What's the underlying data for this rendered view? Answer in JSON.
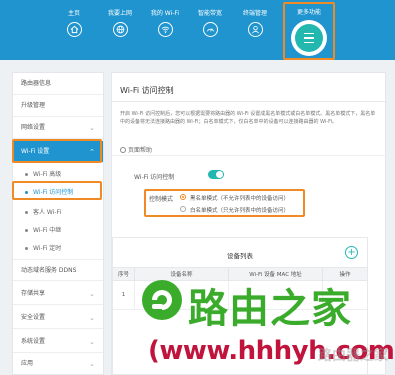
{
  "nav": {
    "items": [
      {
        "label": "主页",
        "icon": "home-icon"
      },
      {
        "label": "我要上网",
        "icon": "globe-icon"
      },
      {
        "label": "我的 Wi-Fi",
        "icon": "wifi-icon"
      },
      {
        "label": "智能带宽",
        "icon": "speed-dial-icon"
      },
      {
        "label": "终端管理",
        "icon": "user-icon"
      }
    ],
    "more_label": "更多功能",
    "more_icon": "menu-icon"
  },
  "sidebar": {
    "items": [
      {
        "label": "路由器信息"
      },
      {
        "label": "升级管理"
      },
      {
        "label": "网络设置"
      },
      {
        "label": "Wi-Fi 设置"
      },
      {
        "label": "动态域名服务 DDNS"
      },
      {
        "label": "存储共享"
      },
      {
        "label": "安全设置"
      },
      {
        "label": "系统设置"
      },
      {
        "label": "应用"
      }
    ],
    "wifi_sub": [
      {
        "label": "Wi-Fi 高级"
      },
      {
        "label": "Wi-Fi 访问控制"
      },
      {
        "label": "客人 Wi-Fi"
      },
      {
        "label": "Wi-Fi 中继"
      },
      {
        "label": "Wi-Fi 定时"
      }
    ]
  },
  "main": {
    "title": "Wi-Fi 访问控制",
    "description": "开启 Wi-Fi 访问控制后，您可以根据需要将路由器的 Wi-Fi 设置成黑名单模式或白名单模式。黑名单模式下，黑名单中的设备将无法连接路由器的 Wi-Fi；白名单模式下，仅白名单中的设备可以连接路由器的 Wi-Fi。",
    "help": "页面帮助",
    "toggle_label": "Wi-Fi 访问控制",
    "toggle_on": true,
    "mode_label": "控制模式",
    "mode_options": [
      {
        "label": "黑名单模式（不允许列表中的设备访问）",
        "selected": true
      },
      {
        "label": "白名单模式（只允许列表中的设备访问）",
        "selected": false
      }
    ],
    "device_list": {
      "title": "设备列表",
      "columns": [
        "序号",
        "设备名称",
        "Wi-Fi 设备 MAC 地址",
        "操作"
      ],
      "rows": [
        {
          "index": "1"
        }
      ]
    }
  },
  "watermark": {
    "brand": "路由之家",
    "url": "(www.hhhyh.com)",
    "faint": "路由器之家"
  },
  "colors": {
    "nav_blue": "#1f94cf",
    "accent_teal": "#22b8b0",
    "highlight_orange": "#f08a24",
    "watermark_green": "#3bab2c",
    "watermark_red": "#c0143c"
  }
}
